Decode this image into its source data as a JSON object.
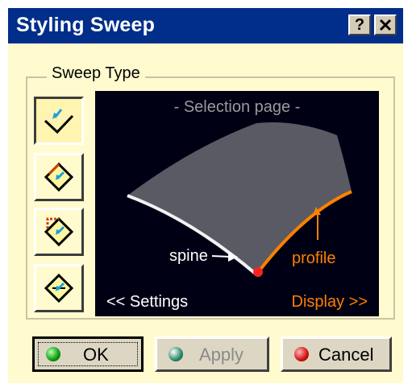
{
  "window": {
    "title": "Styling Sweep"
  },
  "titlebar_buttons": {
    "help": "?",
    "close": "✕"
  },
  "sweep_type": {
    "group_label": "Sweep Type"
  },
  "preview": {
    "header": "- Selection page -",
    "spine_label": "spine",
    "profile_label": "profile",
    "settings_link": "<< Settings",
    "display_link": "Display >>"
  },
  "buttons": {
    "ok": "OK",
    "apply": "Apply",
    "cancel": "Cancel"
  },
  "colors": {
    "title_bg": "#002e8a",
    "dialog_bg": "#fffbcf",
    "preview_bg": "#000014",
    "accent_orange": "#ff8000"
  }
}
